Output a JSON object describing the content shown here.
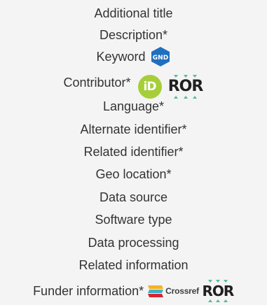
{
  "menu": {
    "items": [
      {
        "label": "Additional title"
      },
      {
        "label": "Description*"
      },
      {
        "label": "Keyword"
      },
      {
        "label": "Contributor*"
      },
      {
        "label": "Language*"
      },
      {
        "label": "Alternate identifier*"
      },
      {
        "label": "Related identifier*"
      },
      {
        "label": "Geo location*"
      },
      {
        "label": "Data source"
      },
      {
        "label": "Software type"
      },
      {
        "label": "Data processing"
      },
      {
        "label": "Related information"
      },
      {
        "label": "Funder information*"
      }
    ]
  },
  "icons": {
    "gnd": {
      "name": "gnd-icon",
      "text": "GND",
      "color": "#1f6fbf"
    },
    "orcid": {
      "name": "orcid-icon",
      "text": "iD",
      "color": "#a6ce39"
    },
    "ror": {
      "name": "ror-icon",
      "text": "ROR",
      "accent": "#53baa1"
    },
    "crossref": {
      "name": "crossref-icon",
      "text": "Crossref"
    }
  },
  "colors": {
    "background": "#f4f4f4",
    "text": "#333333"
  }
}
